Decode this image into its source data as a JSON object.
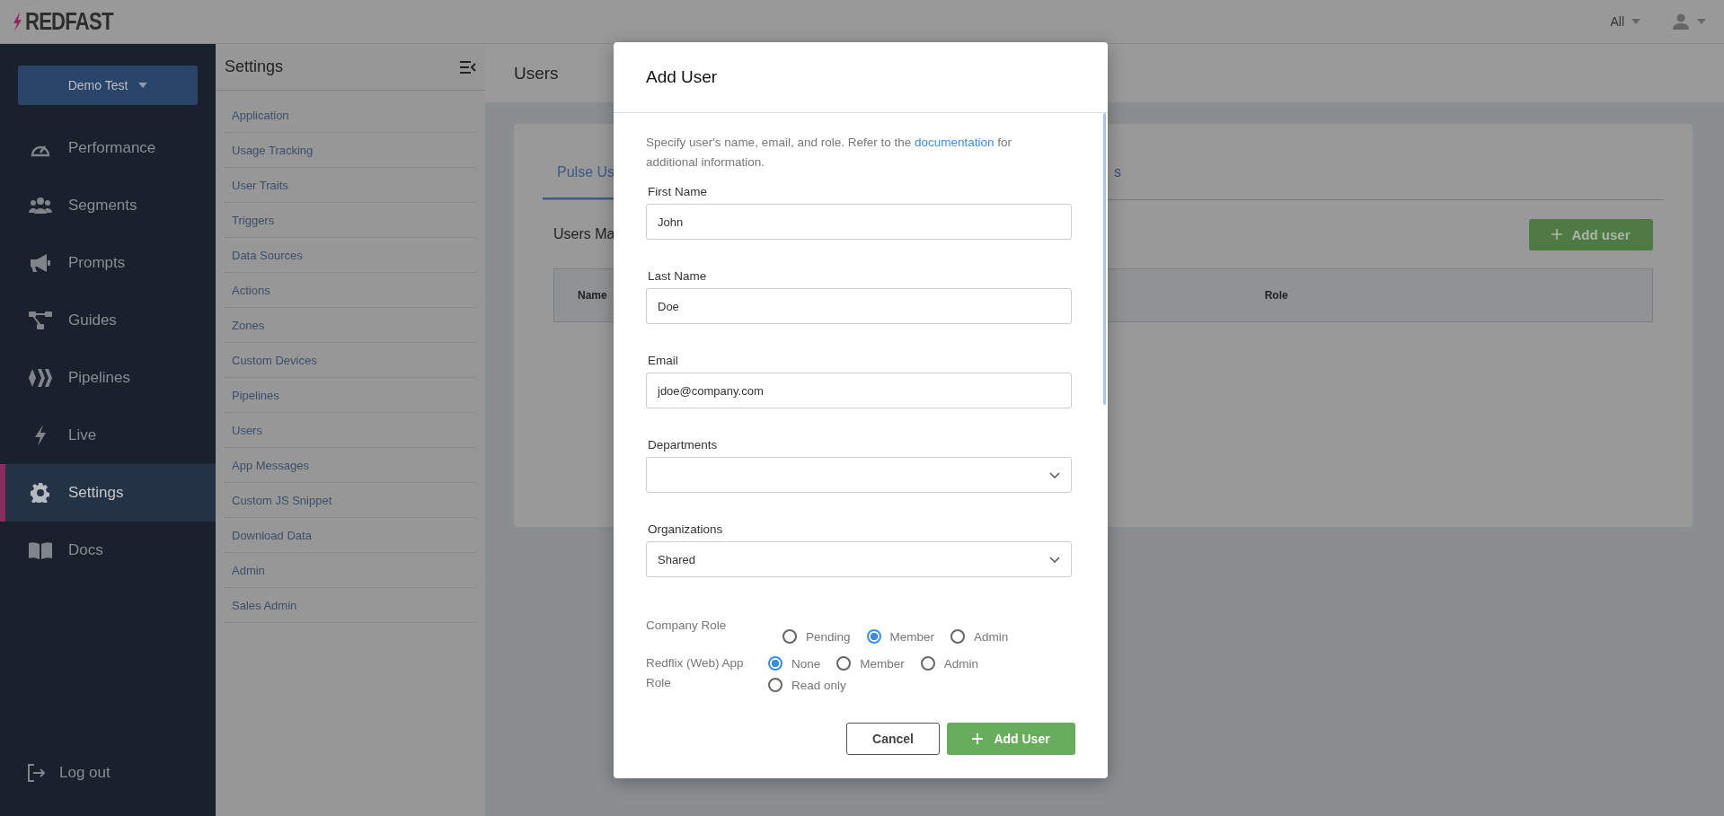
{
  "topbar": {
    "logo": "REDFAST",
    "filter": "All"
  },
  "nav": {
    "account": "Demo Test",
    "items": [
      {
        "label": "Performance",
        "selected": false
      },
      {
        "label": "Segments",
        "selected": false
      },
      {
        "label": "Prompts",
        "selected": false
      },
      {
        "label": "Guides",
        "selected": false
      },
      {
        "label": "Pipelines",
        "selected": false
      },
      {
        "label": "Live",
        "selected": false
      },
      {
        "label": "Settings",
        "selected": true
      },
      {
        "label": "Docs",
        "selected": false
      }
    ],
    "logout": "Log out"
  },
  "settings": {
    "title": "Settings",
    "items": [
      "Application",
      "Usage Tracking",
      "User Traits",
      "Triggers",
      "Data Sources",
      "Actions",
      "Zones",
      "Custom Devices",
      "Pipelines",
      "Users",
      "App Messages",
      "Custom JS Snippet",
      "Download Data",
      "Admin",
      "Sales Admin"
    ]
  },
  "page": {
    "title": "Users",
    "tabs": [
      {
        "label": "Pulse Us",
        "selected": true
      },
      {
        "label": "s",
        "selected": false
      }
    ],
    "section_title": "Users Ma",
    "add_button": "Add user",
    "table": {
      "columns": [
        "Name",
        "Role"
      ]
    }
  },
  "modal": {
    "title": "Add User",
    "intro_before": "Specify user's name, email, and role. Refer to the",
    "intro_link": "documentation",
    "intro_after": "for additional information.",
    "fields": [
      {
        "kind": "text",
        "label": "First Name",
        "value": "John"
      },
      {
        "kind": "text",
        "label": "Last Name",
        "value": "Doe"
      },
      {
        "kind": "text",
        "label": "Email",
        "value": "jdoe@company.com"
      },
      {
        "kind": "select",
        "label": "Departments"
      },
      {
        "kind": "select",
        "label": "Organizations",
        "value": "Shared"
      }
    ],
    "radio_groups": [
      {
        "label": "Company Role",
        "options": [
          {
            "label": "Pending",
            "selected": false
          },
          {
            "label": "Member",
            "selected": true
          },
          {
            "label": "Admin",
            "selected": false
          }
        ]
      },
      {
        "label": "Redflix (Web) App Role",
        "options": [
          {
            "label": "None",
            "selected": true
          },
          {
            "label": "Member",
            "selected": false
          },
          {
            "label": "Admin",
            "selected": false
          },
          {
            "label": "Read only",
            "selected": false
          }
        ]
      }
    ],
    "cancel": "Cancel",
    "submit": "Add User"
  }
}
